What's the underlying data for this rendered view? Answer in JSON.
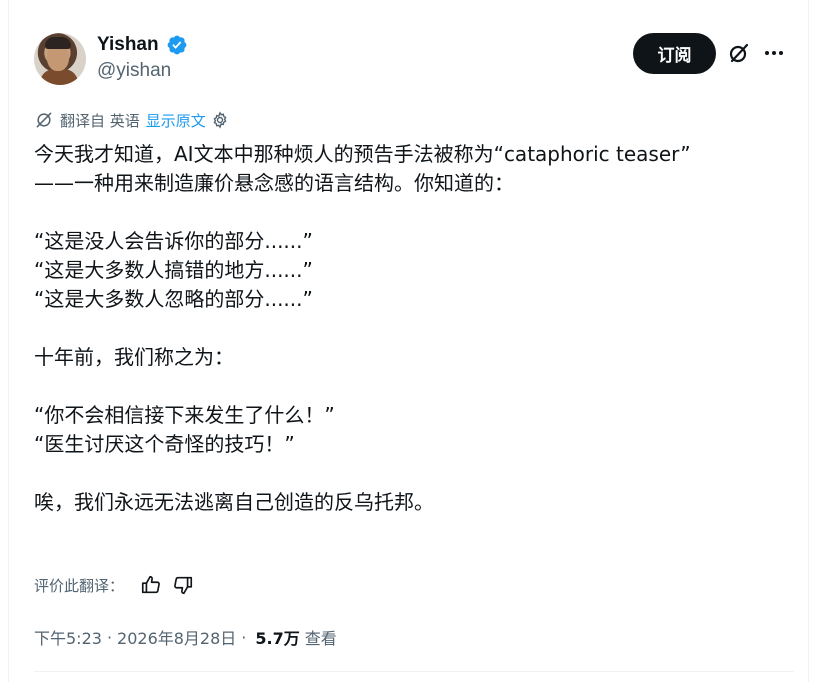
{
  "author": {
    "name": "Yishan",
    "handle": "@yishan",
    "verified": true
  },
  "header": {
    "subscribe_label": "订阅"
  },
  "translation": {
    "from_label": "翻译自 英语",
    "show_original_label": "显示原文"
  },
  "tweet": {
    "lines": [
      "今天我才知道，AI文本中那种烦人的预告手法被称为“cataphoric teaser”",
      "——一种用来制造廉价悬念感的语言结构。你知道的：",
      "",
      "“这是没人会告诉你的部分......”",
      "“这是大多数人搞错的地方......”",
      "“这是大多数人忽略的部分......”",
      "",
      "十年前，我们称之为：",
      "",
      "“你不会相信接下来发生了什么！”",
      "“医生讨厌这个奇怪的技巧！”",
      "",
      "唉，我们永远无法逃离自己创造的反乌托邦。"
    ]
  },
  "rate_translation": {
    "label": "评价此翻译："
  },
  "meta": {
    "time": "下午5:23",
    "separator1": "·",
    "date": "2026年8月28日",
    "separator2": "·",
    "views": "5.7万",
    "views_label": "查看"
  },
  "colors": {
    "text": "#0f1419",
    "secondary": "#536471",
    "link": "#1d9bf0",
    "verified": "#1d9bf0",
    "button_bg": "#0f1419"
  },
  "icons": [
    "verified-badge-icon",
    "grok-icon",
    "more-icon",
    "translate-icon",
    "settings-gear-icon",
    "thumbs-up-icon",
    "thumbs-down-icon"
  ]
}
